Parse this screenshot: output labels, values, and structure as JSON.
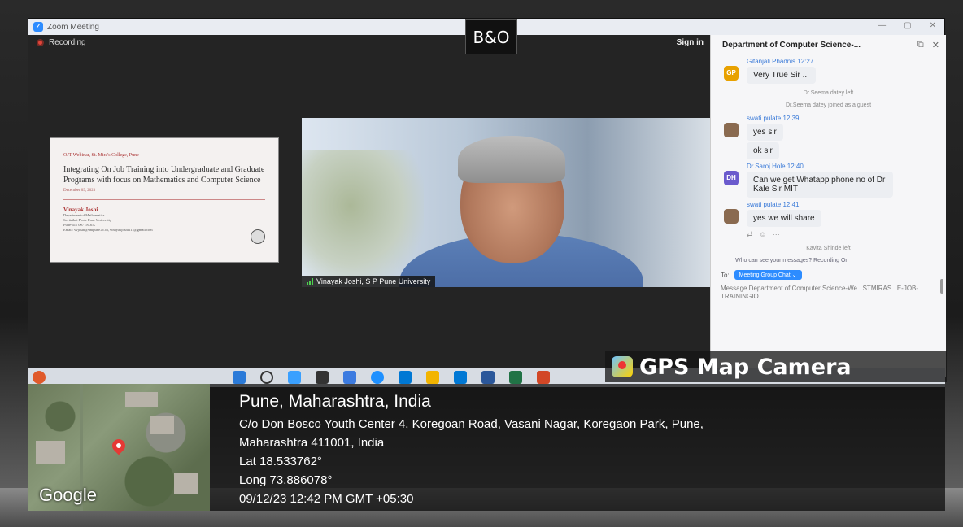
{
  "window": {
    "title": "Zoom Meeting"
  },
  "meeting": {
    "recording_label": "Recording",
    "brand_logo": "B&O",
    "sign_in": "Sign in",
    "slide": {
      "header": "OJT Webinar, St. Mira's College, Pune",
      "title": "Integrating On Job Training into Undergraduate and Graduate Programs with focus on Mathematics and Computer Science",
      "date": "December 09, 2023",
      "author": "Vinayak Joshi",
      "affil_1": "Department of Mathematics",
      "affil_2": "Savitribai Phule Pune University",
      "affil_3": "Pune-411 007 INDIA",
      "email": "Email: vvjoshi@unipune.ac.in, vinayakjoshi111@gmail.com"
    },
    "participant_name": "Vinayak Joshi, S P Pune University"
  },
  "chat": {
    "title": "Department of Computer Science-...",
    "messages": [
      {
        "sender": "Gitanjali Phadnis 12:27",
        "initials": "GP",
        "color": "#e8a100",
        "text": "Very True Sir ..."
      },
      {
        "system": "Dr.Seema datey left"
      },
      {
        "system": "Dr.Seema datey joined as a guest"
      },
      {
        "sender": "swati pulate 12:39",
        "initials": "SP",
        "color": "#8a6a50",
        "text": "yes sir",
        "text2": "ok sir"
      },
      {
        "sender": "Dr.Saroj Hole 12:40",
        "initials": "DH",
        "color": "#6a5acd",
        "text": "Can we get Whatapp phone no of Dr Kale Sir MIT"
      },
      {
        "sender": "swati pulate 12:41",
        "initials": "SP",
        "color": "#8a6a50",
        "text": "yes we will share"
      },
      {
        "system": "Kavita Shinde left"
      }
    ],
    "privacy_note": "Who can see your messages? Recording On",
    "to_label": "To:",
    "to_target": "Meeting Group Chat ⌄",
    "composer_placeholder": "Message Department of Computer Science-We...STMIRAS...E-JOB-TRAININGIO..."
  },
  "gps": {
    "brand": "GPS Map Camera",
    "map_label": "Google",
    "city": "Pune, Maharashtra, India",
    "address_1": "C/o Don Bosco Youth Center 4, Koregoan Road, Vasani Nagar, Koregaon Park, Pune,",
    "address_2": "Maharashtra 411001, India",
    "lat": "Lat 18.533762°",
    "long": "Long 73.886078°",
    "timestamp": "09/12/23 12:42 PM GMT +05:30"
  }
}
